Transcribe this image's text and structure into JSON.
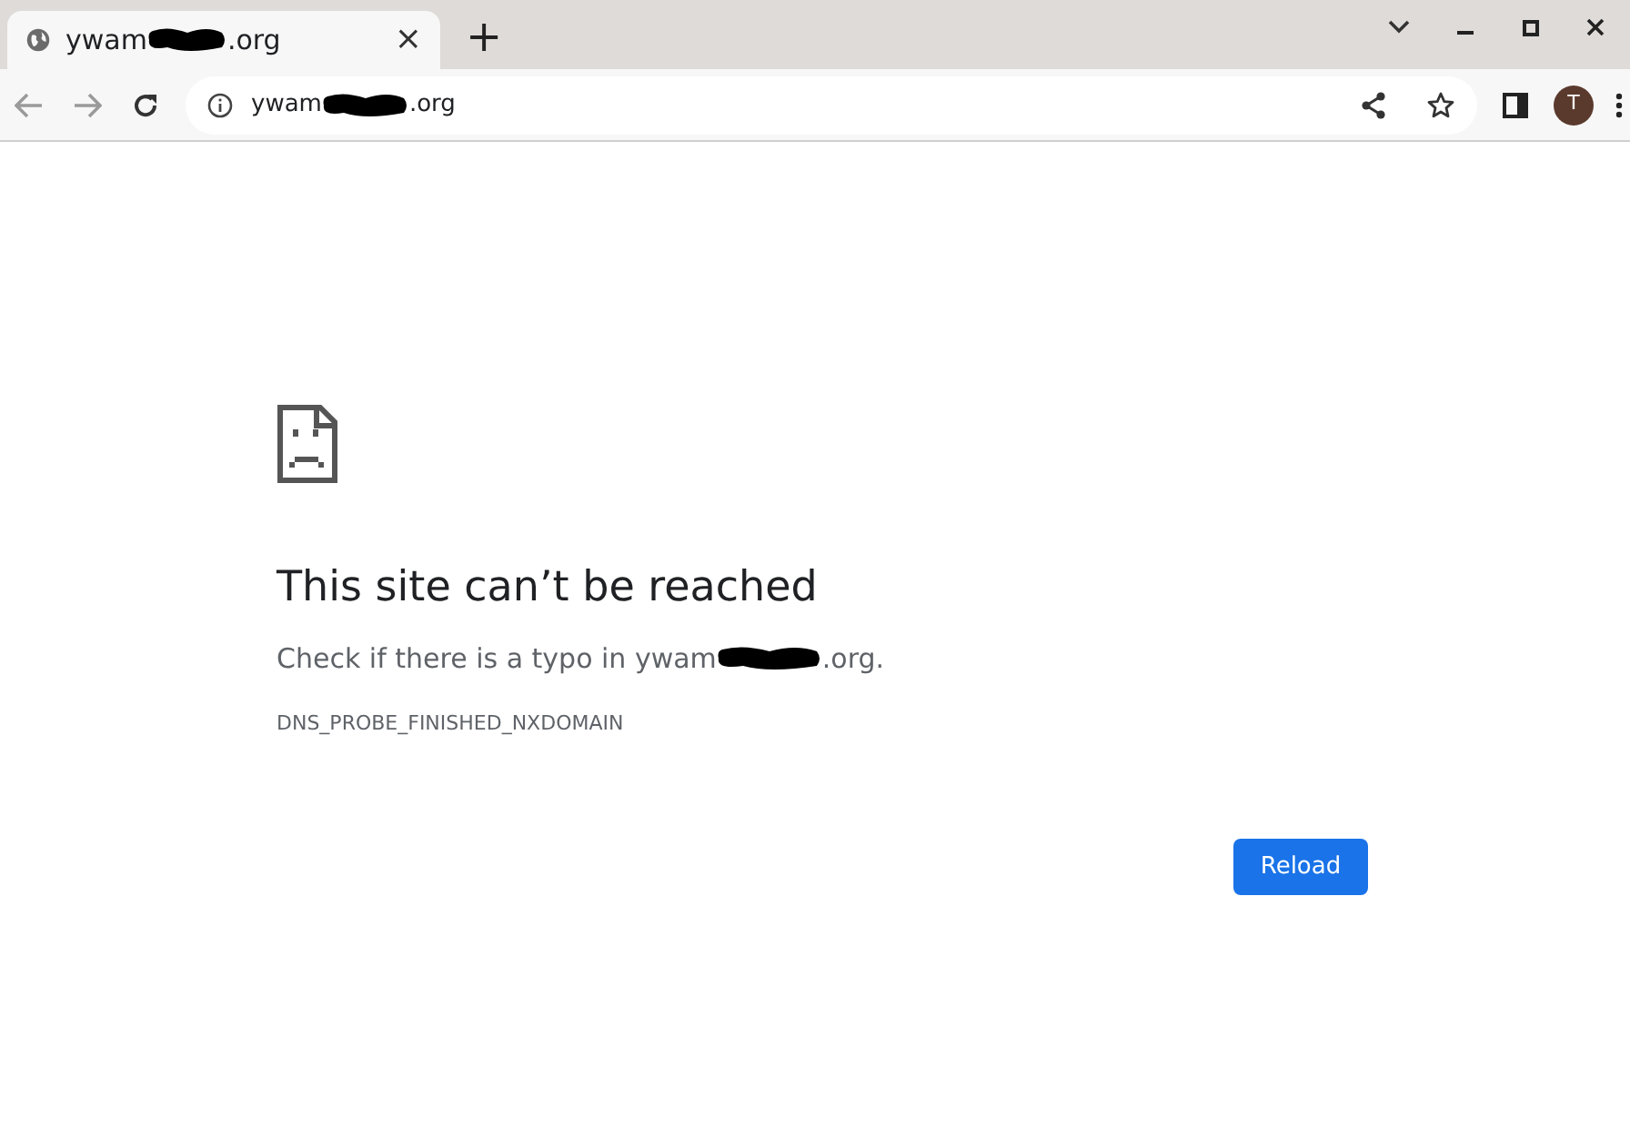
{
  "tab": {
    "title_start": "ywam",
    "title_end": ".org",
    "selected": true,
    "close": "×"
  },
  "new_tab": "+",
  "address_bar": {
    "value_start": "ywam",
    "value_end": ".org"
  },
  "avatar": {
    "initial": "T",
    "color": "#5b3a2e"
  },
  "error": {
    "heading": "This site can’t be reached",
    "message_start": "Check if there is a typo in ywam",
    "message_end": ".org.",
    "code": "DNS_PROBE_FINISHED_NXDOMAIN"
  },
  "reload_button": "Reload"
}
